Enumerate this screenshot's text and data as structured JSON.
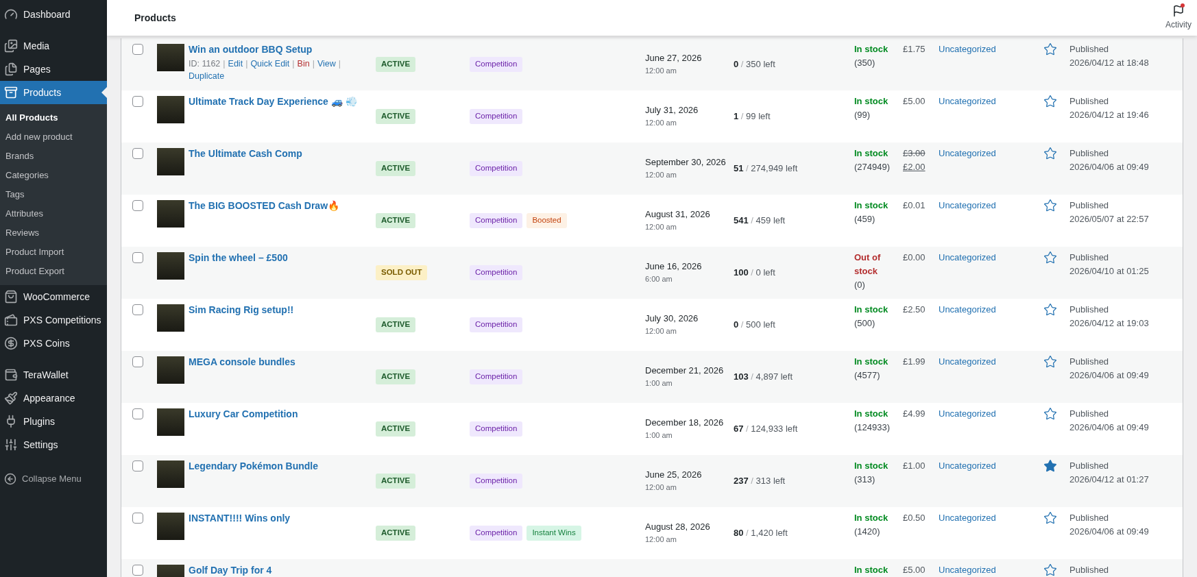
{
  "sidebar": {
    "groups": [
      [
        {
          "label": "Dashboard",
          "kind": "dashboard",
          "selected": false
        }
      ],
      [
        {
          "label": "Media",
          "kind": "media",
          "selected": false
        },
        {
          "label": "Pages",
          "kind": "pages",
          "selected": false
        },
        {
          "label": "Products",
          "kind": "products",
          "selected": true,
          "children": [
            {
              "label": "All Products",
              "selected": true
            },
            {
              "label": "Add new product",
              "selected": false
            },
            {
              "label": "Brands",
              "selected": false
            },
            {
              "label": "Categories",
              "selected": false
            },
            {
              "label": "Tags",
              "selected": false
            },
            {
              "label": "Attributes",
              "selected": false
            },
            {
              "label": "Reviews",
              "selected": false
            },
            {
              "label": "Product Import",
              "selected": false
            },
            {
              "label": "Product Export",
              "selected": false
            }
          ]
        },
        {
          "label": "WooCommerce",
          "kind": "woo",
          "selected": false
        },
        {
          "label": "PXS Competitions",
          "kind": "tickets",
          "selected": false
        },
        {
          "label": "PXS Coins",
          "kind": "coins",
          "selected": false
        }
      ],
      [
        {
          "label": "TeraWallet",
          "kind": "wallet",
          "selected": false
        },
        {
          "label": "Appearance",
          "kind": "brush",
          "selected": false
        },
        {
          "label": "Plugins",
          "kind": "plug",
          "selected": false
        },
        {
          "label": "Settings",
          "kind": "settings",
          "selected": false
        }
      ]
    ],
    "collapse": "Collapse Menu"
  },
  "top_bar": {
    "title": "Products",
    "activity": {
      "label": "Activity",
      "unread": true
    }
  },
  "rows": [
    {
      "checked": false,
      "name": "Win an outdoor BBQ Setup",
      "actions": [
        {
          "label": "ID: 1162",
          "kind": "meta"
        },
        {
          "label": "|",
          "kind": "sep"
        },
        {
          "label": "Edit",
          "kind": "link"
        },
        {
          "label": "|",
          "kind": "sep"
        },
        {
          "label": "Quick Edit",
          "kind": "link"
        },
        {
          "label": "|",
          "kind": "sep"
        },
        {
          "label": "Bin",
          "kind": "danger"
        },
        {
          "label": "|",
          "kind": "sep"
        },
        {
          "label": "View",
          "kind": "link"
        },
        {
          "label": "|",
          "kind": "sep"
        },
        {
          "label": "Duplicate",
          "kind": "link"
        }
      ],
      "status": {
        "label": "ACTIVE",
        "kind": "active"
      },
      "tags": [
        {
          "label": "Competition",
          "kind": "competition"
        }
      ],
      "date": "June 27, 2026",
      "time": "12:00 am",
      "sold": "0",
      "slash": "/",
      "left": "350 left",
      "stock": {
        "label": "In stock",
        "kind": "in"
      },
      "stock_qty": "(350)",
      "price": {
        "kind": "regular",
        "value": "£1.75"
      },
      "category": "Uncategorized",
      "featured": false,
      "published": "Published",
      "published_at": "2026/04/12 at 18:48"
    },
    {
      "checked": false,
      "name": "Ultimate Track Day Experience 🚙 💨",
      "status": {
        "label": "ACTIVE",
        "kind": "active"
      },
      "tags": [
        {
          "label": "Competition",
          "kind": "competition"
        }
      ],
      "date": "July 31, 2026",
      "time": "12:00 am",
      "sold": "1",
      "slash": "/",
      "left": "99 left",
      "stock": {
        "label": "In stock",
        "kind": "in"
      },
      "stock_qty": "(99)",
      "price": {
        "kind": "regular",
        "value": "£5.00"
      },
      "category": "Uncategorized",
      "featured": false,
      "published": "Published",
      "published_at": "2026/04/12 at 19:46"
    },
    {
      "checked": false,
      "name": "The Ultimate Cash Comp",
      "status": {
        "label": "ACTIVE",
        "kind": "active"
      },
      "tags": [
        {
          "label": "Competition",
          "kind": "competition"
        }
      ],
      "date": "September 30, 2026",
      "time": "12:00 am",
      "sold": "51",
      "slash": "/",
      "left": "274,949 left",
      "stock": {
        "label": "In stock",
        "kind": "in"
      },
      "stock_qty": "(274949)",
      "price": {
        "kind": "sale",
        "old": "£3.00",
        "new": "£2.00"
      },
      "category": "Uncategorized",
      "featured": false,
      "published": "Published",
      "published_at": "2026/04/06 at 09:49"
    },
    {
      "checked": false,
      "name": "The BIG BOOSTED Cash Draw🔥",
      "status": {
        "label": "ACTIVE",
        "kind": "active"
      },
      "tags": [
        {
          "label": "Competition",
          "kind": "competition"
        },
        {
          "label": "Boosted",
          "kind": "boosted"
        }
      ],
      "date": "August 31, 2026",
      "time": "12:00 am",
      "sold": "541",
      "slash": "/",
      "left": "459 left",
      "stock": {
        "label": "In stock",
        "kind": "in"
      },
      "stock_qty": "(459)",
      "price": {
        "kind": "regular",
        "value": "£0.01"
      },
      "category": "Uncategorized",
      "featured": false,
      "published": "Published",
      "published_at": "2026/05/07 at 22:57"
    },
    {
      "checked": false,
      "name": "Spin the wheel – £500",
      "status": {
        "label": "SOLD OUT",
        "kind": "sold_out"
      },
      "tags": [
        {
          "label": "Competition",
          "kind": "competition"
        }
      ],
      "date": "June 16, 2026",
      "time": "6:00 am",
      "sold": "100",
      "slash": "/",
      "left": "0 left",
      "stock": {
        "label": "Out of stock",
        "kind": "out"
      },
      "stock_qty": "(0)",
      "price": {
        "kind": "regular",
        "value": "£0.00"
      },
      "category": "Uncategorized",
      "featured": false,
      "published": "Published",
      "published_at": "2026/04/10 at 01:25"
    },
    {
      "checked": false,
      "name": "Sim Racing Rig setup!!",
      "status": {
        "label": "ACTIVE",
        "kind": "active"
      },
      "tags": [
        {
          "label": "Competition",
          "kind": "competition"
        }
      ],
      "date": "July 30, 2026",
      "time": "12:00 am",
      "sold": "0",
      "slash": "/",
      "left": "500 left",
      "stock": {
        "label": "In stock",
        "kind": "in"
      },
      "stock_qty": "(500)",
      "price": {
        "kind": "regular",
        "value": "£2.50"
      },
      "category": "Uncategorized",
      "featured": false,
      "published": "Published",
      "published_at": "2026/04/12 at 19:03"
    },
    {
      "checked": false,
      "name": "MEGA console bundles",
      "status": {
        "label": "ACTIVE",
        "kind": "active"
      },
      "tags": [
        {
          "label": "Competition",
          "kind": "competition"
        }
      ],
      "date": "December 21, 2026",
      "time": "1:00 am",
      "sold": "103",
      "slash": "/",
      "left": "4,897 left",
      "stock": {
        "label": "In stock",
        "kind": "in"
      },
      "stock_qty": "(4577)",
      "price": {
        "kind": "regular",
        "value": "£1.99"
      },
      "category": "Uncategorized",
      "featured": false,
      "published": "Published",
      "published_at": "2026/04/06 at 09:49"
    },
    {
      "checked": false,
      "name": "Luxury Car Competition",
      "status": {
        "label": "ACTIVE",
        "kind": "active"
      },
      "tags": [
        {
          "label": "Competition",
          "kind": "competition"
        }
      ],
      "date": "December 18, 2026",
      "time": "1:00 am",
      "sold": "67",
      "slash": "/",
      "left": "124,933 left",
      "stock": {
        "label": "In stock",
        "kind": "in"
      },
      "stock_qty": "(124933)",
      "price": {
        "kind": "regular",
        "value": "£4.99"
      },
      "category": "Uncategorized",
      "featured": false,
      "published": "Published",
      "published_at": "2026/04/06 at 09:49"
    },
    {
      "checked": false,
      "name": "Legendary Pokémon Bundle",
      "status": {
        "label": "ACTIVE",
        "kind": "active"
      },
      "tags": [
        {
          "label": "Competition",
          "kind": "competition"
        }
      ],
      "date": "June 25, 2026",
      "time": "12:00 am",
      "sold": "237",
      "slash": "/",
      "left": "313 left",
      "stock": {
        "label": "In stock",
        "kind": "in"
      },
      "stock_qty": "(313)",
      "price": {
        "kind": "regular",
        "value": "£1.00"
      },
      "category": "Uncategorized",
      "featured": true,
      "published": "Published",
      "published_at": "2026/04/12 at 01:27"
    },
    {
      "checked": false,
      "name": "INSTANT!!!! Wins only",
      "status": {
        "label": "ACTIVE",
        "kind": "active"
      },
      "tags": [
        {
          "label": "Competition",
          "kind": "competition"
        },
        {
          "label": "Instant Wins",
          "kind": "instant"
        }
      ],
      "date": "August 28, 2026",
      "time": "12:00 am",
      "sold": "80",
      "slash": "/",
      "left": "1,420 left",
      "stock": {
        "label": "In stock",
        "kind": "in"
      },
      "stock_qty": "(1420)",
      "price": {
        "kind": "regular",
        "value": "£0.50"
      },
      "category": "Uncategorized",
      "featured": false,
      "published": "Published",
      "published_at": "2026/04/06 at 09:49"
    },
    {
      "checked": false,
      "name": "Golf Day Trip for 4",
      "stock": {
        "label": "In stock",
        "kind": "in"
      },
      "price": {
        "kind": "regular",
        "value": "£5.00"
      },
      "category": "Uncategorized",
      "featured": false,
      "published": "Published"
    }
  ]
}
